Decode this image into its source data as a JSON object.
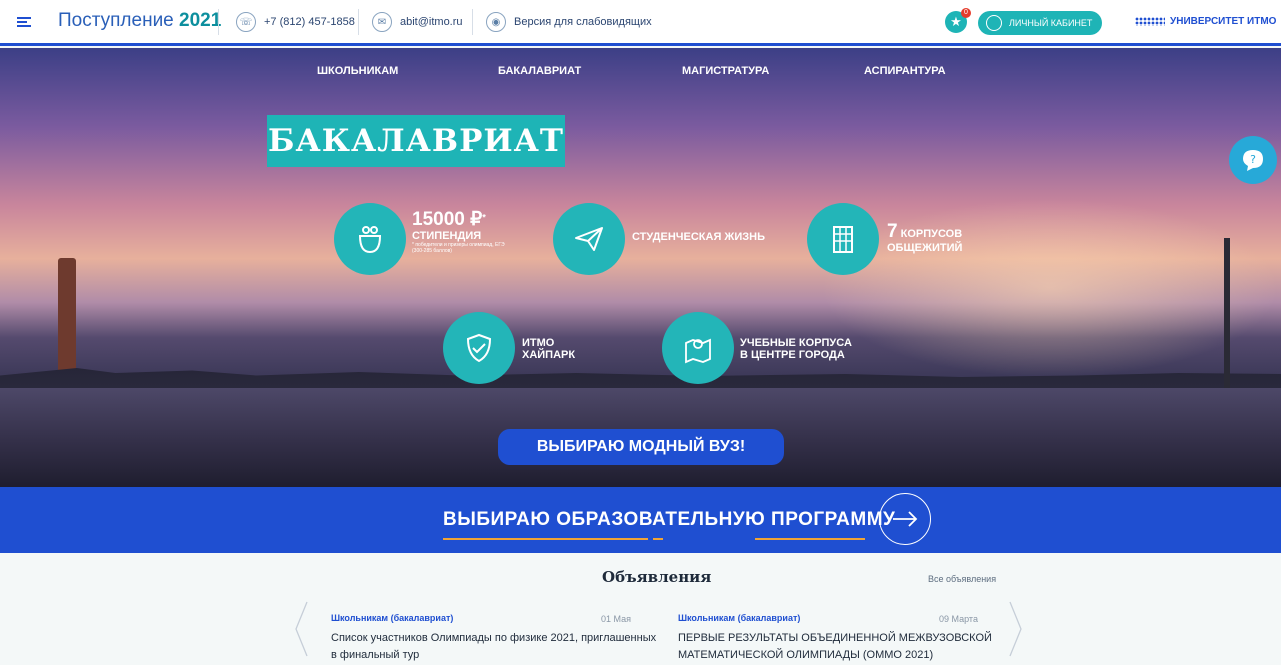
{
  "header": {
    "title_prefix": "Поступление",
    "title_year": "2021",
    "phone": "+7 (812) 457-1858",
    "email": "abit@itmo.ru",
    "accessibility": "Версия для слабовидящих",
    "favorites_count": "0",
    "cabinet": "ЛИЧНЫЙ КАБИНЕТ",
    "university": "УНИВЕРСИТЕТ ИТМО"
  },
  "hero": {
    "nav": [
      "ШКОЛЬНИКАМ",
      "БАКАЛАВРИАТ",
      "МАГИСТРАТУРА",
      "АСПИРАНТУРА"
    ],
    "title": "БАКАЛАВРИАТ",
    "features": {
      "stipend_amount": "15000 ₽",
      "stipend_sup": "*",
      "stipend_label": "СТИПЕНДИЯ",
      "stipend_note": "* победители и призеры олимпиад, ЕГЭ (300-285 баллов)",
      "student_life": "СТУДЕНЧЕСКАЯ ЖИЗНЬ",
      "dorm_count": "7",
      "dorm_line1": "КОРПУСОВ",
      "dorm_line2": "ОБЩЕЖИТИЙ",
      "park_line1": "ИТМО",
      "park_line2": "ХАЙПАРК",
      "campus_line1": "УЧЕБНЫЕ КОРПУСА",
      "campus_line2": "В ЦЕНТРЕ ГОРОДА"
    },
    "cta": "ВЫБИРАЮ МОДНЫЙ ВУЗ!"
  },
  "program_bar": {
    "label": "ВЫБИРАЮ ОБРАЗОВАТЕЛЬНУЮ ПРОГРАММУ"
  },
  "announcements": {
    "title": "Объявления",
    "all_link": "Все объявления",
    "items": [
      {
        "category": "Школьникам (бакалавриат)",
        "date": "01 Мая",
        "text": "Список участников Олимпиады по физике 2021, приглашенных в финальный тур"
      },
      {
        "category": "Школьникам (бакалавриат)",
        "date": "09 Марта",
        "text": "ПЕРВЫЕ РЕЗУЛЬТАТЫ ОБЪЕДИНЕННОЙ МЕЖВУЗОВСКОЙ МАТЕМАТИЧЕСКОЙ ОЛИМПИАДЫ (ОММО 2021)"
      }
    ]
  },
  "colors": {
    "brand_blue": "#1f4fd1",
    "teal": "#1eb4b6",
    "accent_orange": "#f0a436"
  }
}
